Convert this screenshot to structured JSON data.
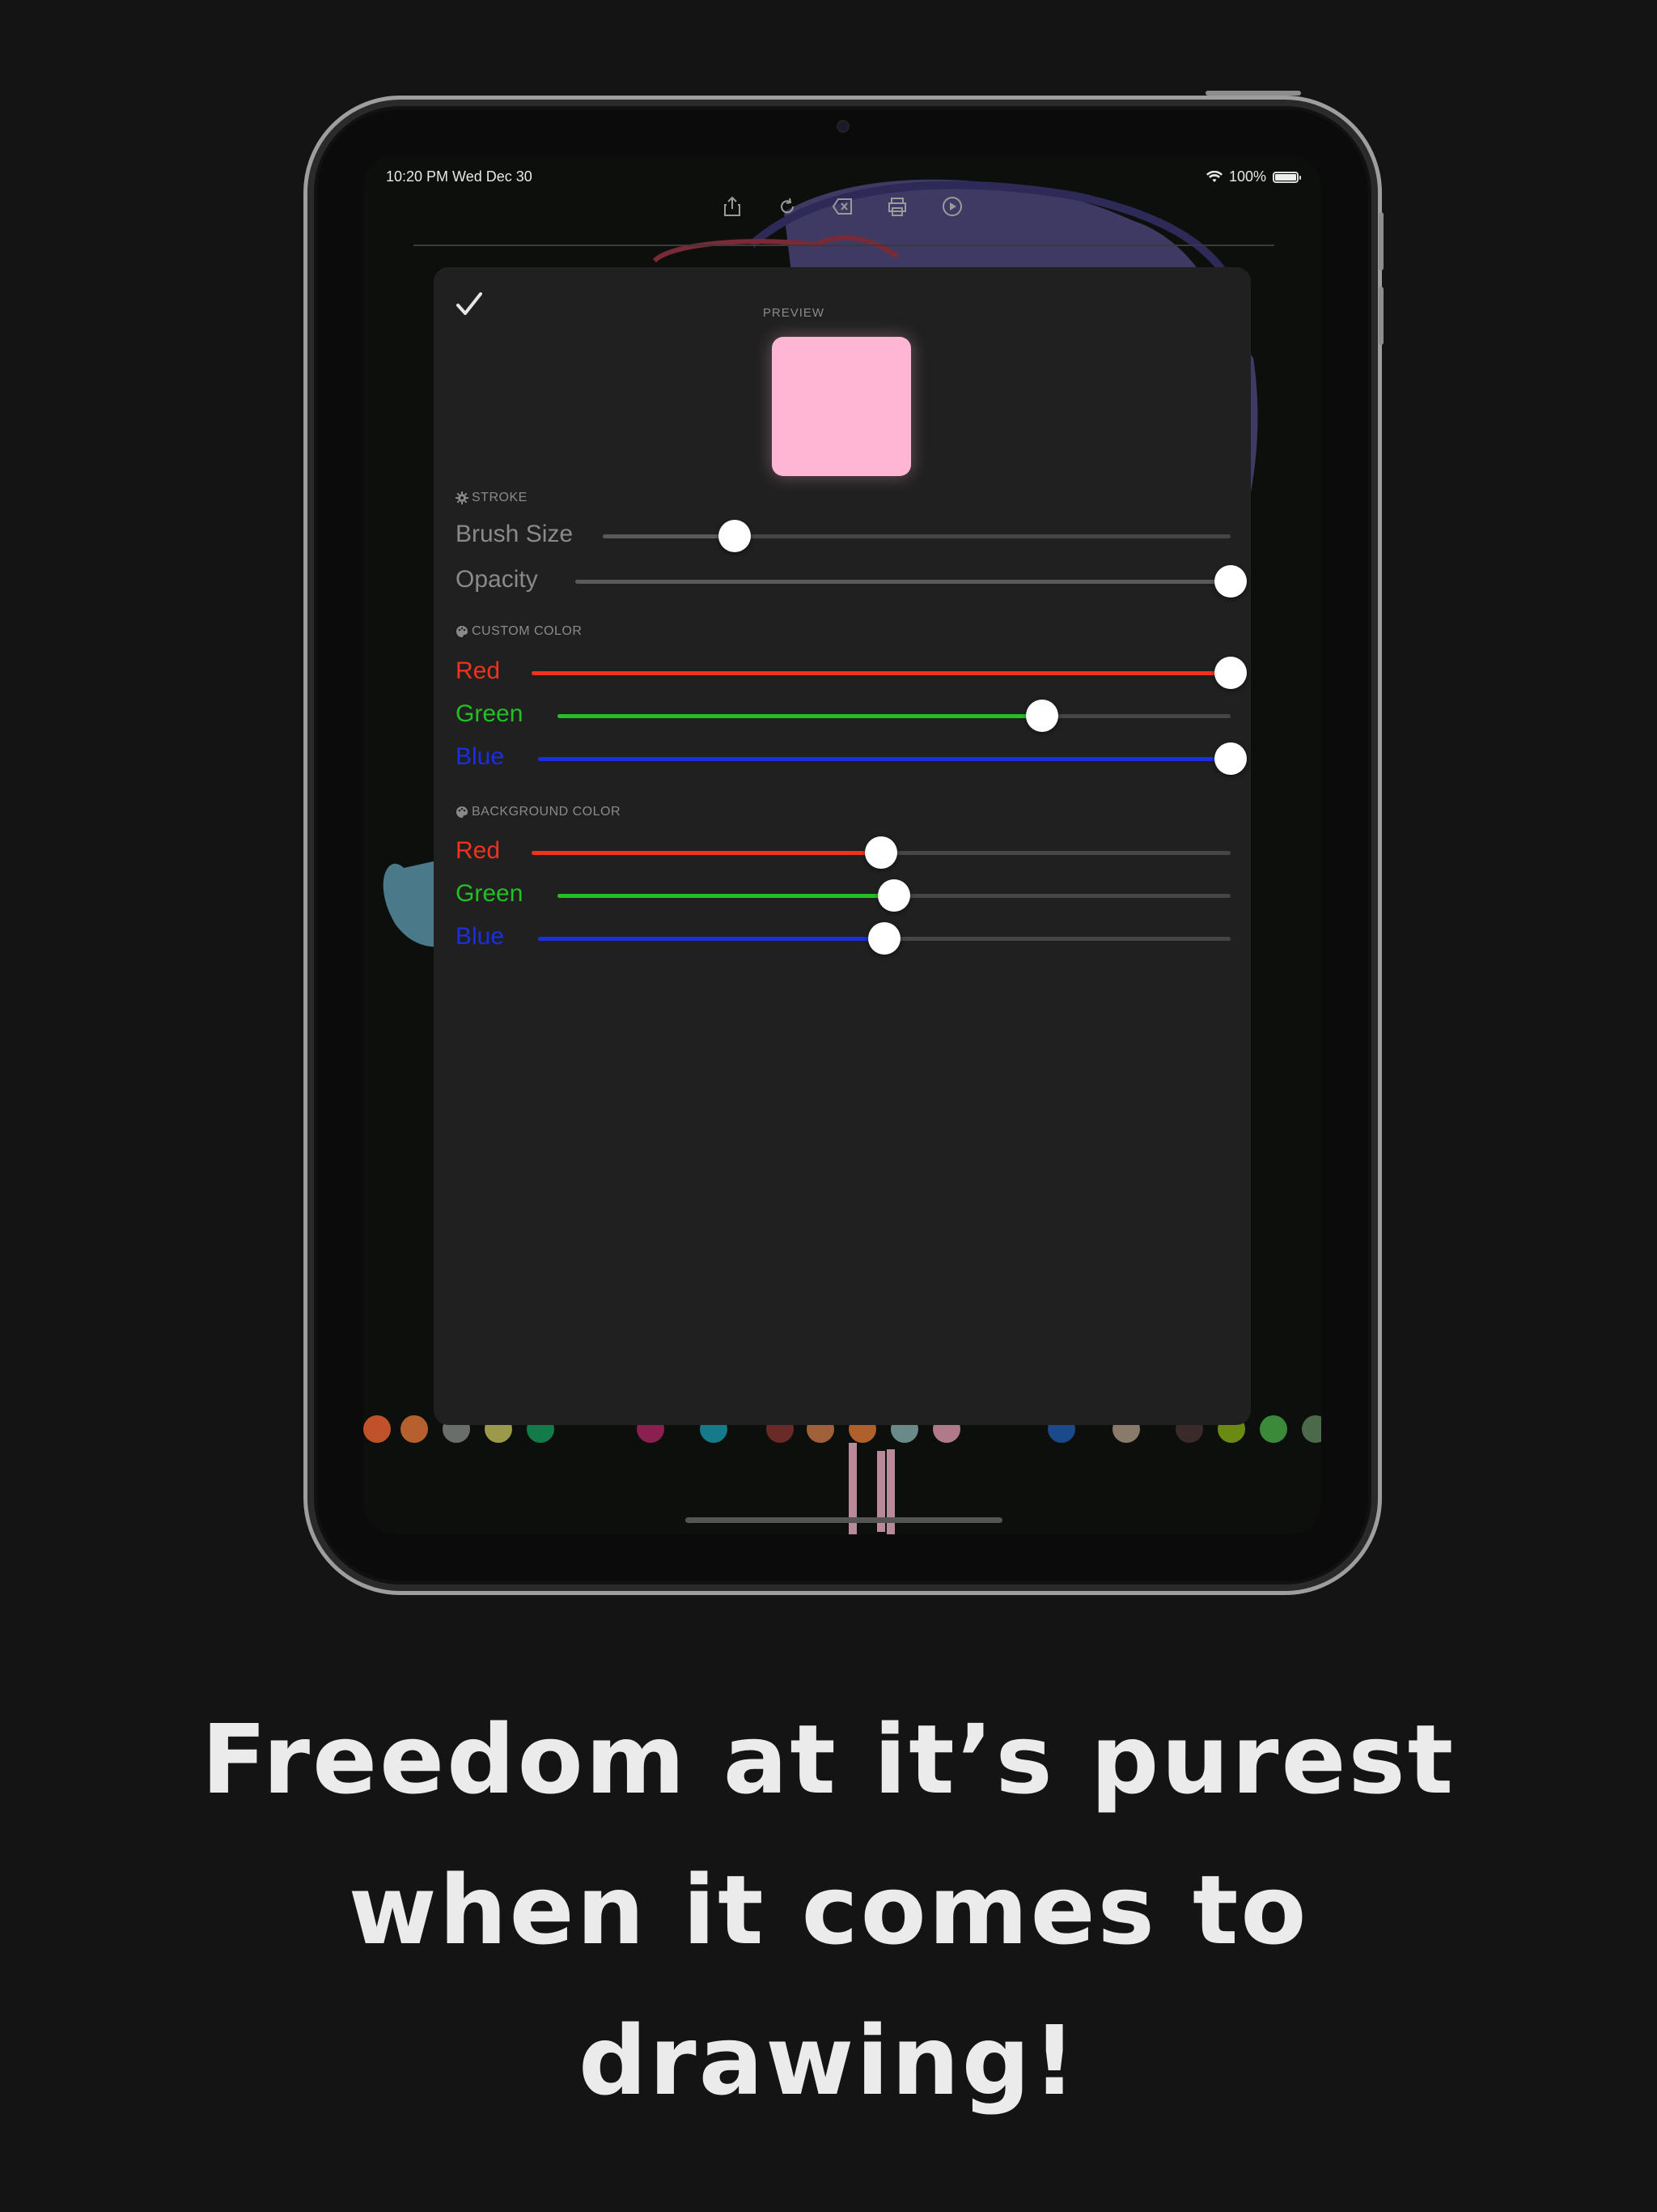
{
  "status_bar": {
    "time": "10:20 PM   Wed Dec 30",
    "battery": "100%"
  },
  "toolbar": {
    "icons": [
      "share-icon",
      "redo-icon",
      "clear-icon",
      "print-icon",
      "play-icon"
    ]
  },
  "panel": {
    "confirm_icon": "checkmark-icon",
    "preview_label": "PREVIEW",
    "preview_color": "#ffb6d5",
    "stroke": {
      "title": "STROKE",
      "brush_size": {
        "label": "Brush Size",
        "value": 0.21
      },
      "opacity": {
        "label": "Opacity",
        "value": 1.0
      }
    },
    "custom_color": {
      "title": "CUSTOM COLOR",
      "red": {
        "label": "Red",
        "value": 1.0
      },
      "green": {
        "label": "Green",
        "value": 0.72
      },
      "blue": {
        "label": "Blue",
        "value": 1.0
      }
    },
    "background_color": {
      "title": "BACKGROUND COLOR",
      "red": {
        "label": "Red",
        "value": 0.5
      },
      "green": {
        "label": "Green",
        "value": 0.5
      },
      "blue": {
        "label": "Blue",
        "value": 0.5
      }
    }
  },
  "colors": {
    "red": "#f0321e",
    "green": "#22c022",
    "blue": "#1a2fe0",
    "stroke_label": "#8a8a8a",
    "stroke_fill": "#5a5a5a"
  },
  "palette": [
    "#c0522a",
    "#b5602e",
    "#6a6e6a",
    "#9a9a4a",
    "#137a4a",
    "#8a2050",
    "#157a8a",
    "#6a2a28",
    "#a0603a",
    "#b0602a",
    "#6a8a8a",
    "#b07a8a",
    "#1a4a8a",
    "#8a7a6a",
    "#3a2a2a",
    "#6a8a12",
    "#3a8a3a",
    "#4a6a4a"
  ],
  "headline": [
    "Freedom at it’s purest",
    "when it comes to",
    "drawing!"
  ]
}
